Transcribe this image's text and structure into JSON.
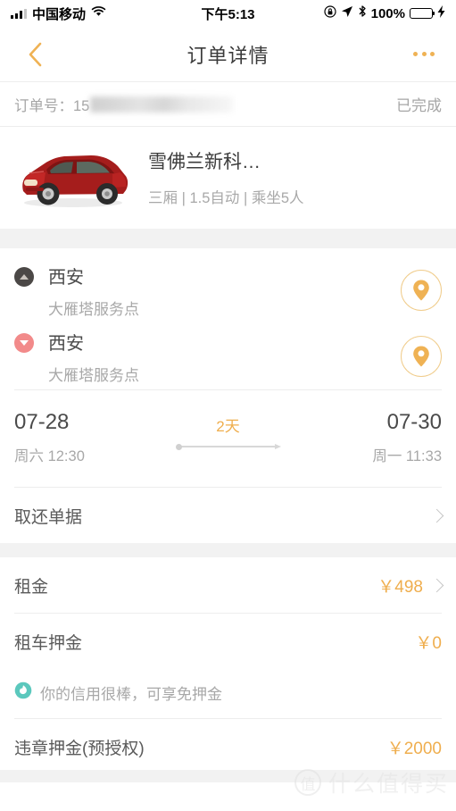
{
  "statusbar": {
    "carrier": "中国移动",
    "time": "下午5:13",
    "battery_percent": "100%",
    "signal_icon": "signal-bars-icon",
    "wifi_icon": "wifi-icon",
    "rotation_lock_icon": "rotation-lock-icon",
    "location_icon": "location-arrow-icon",
    "bluetooth_icon": "bluetooth-icon",
    "battery_icon": "battery-icon",
    "charging_icon": "lightning-bolt-icon"
  },
  "navbar": {
    "title": "订单详情",
    "back_icon": "chevron-left-icon",
    "more_icon": "more-dots-icon"
  },
  "order": {
    "number_label": "订单号：15",
    "status": "已完成"
  },
  "car": {
    "name": "雪佛兰新科…",
    "spec": "三厢 | 1.5自动 | 乘坐5人",
    "image_name": "red-sedan-car-photo"
  },
  "locations": [
    {
      "type": "pickup",
      "city": "西安",
      "store": "大雁塔服务点",
      "marker_icon": "triangle-up-marker-icon",
      "pin_icon": "map-pin-icon"
    },
    {
      "type": "return",
      "city": "西安",
      "store": "大雁塔服务点",
      "marker_icon": "triangle-down-marker-icon",
      "pin_icon": "map-pin-icon"
    }
  ],
  "dates": {
    "start_date": "07-28",
    "start_sub": "周六 12:30",
    "duration": "2天",
    "end_date": "07-30",
    "end_sub": "周一 11:33"
  },
  "rows": {
    "documents": {
      "label": "取还单据",
      "chevron_icon": "chevron-right-icon"
    },
    "rent": {
      "label": "租金",
      "value": "￥498",
      "chevron_icon": "chevron-right-icon"
    },
    "car_deposit": {
      "label": "租车押金",
      "value": "￥0"
    },
    "violation_deposit": {
      "label": "违章押金(预授权)",
      "value": "￥2000"
    }
  },
  "credit": {
    "icon": "sesame-credit-icon",
    "text": "你的信用很棒，可享免押金"
  },
  "watermark": {
    "badge": "值",
    "text": "什么值得买"
  },
  "colors": {
    "accent_orange": "#efae4e",
    "return_marker": "#f28a8a",
    "pickup_marker": "#4b4846",
    "credit_teal": "#5bc8bd",
    "battery_green": "#4cd964"
  }
}
